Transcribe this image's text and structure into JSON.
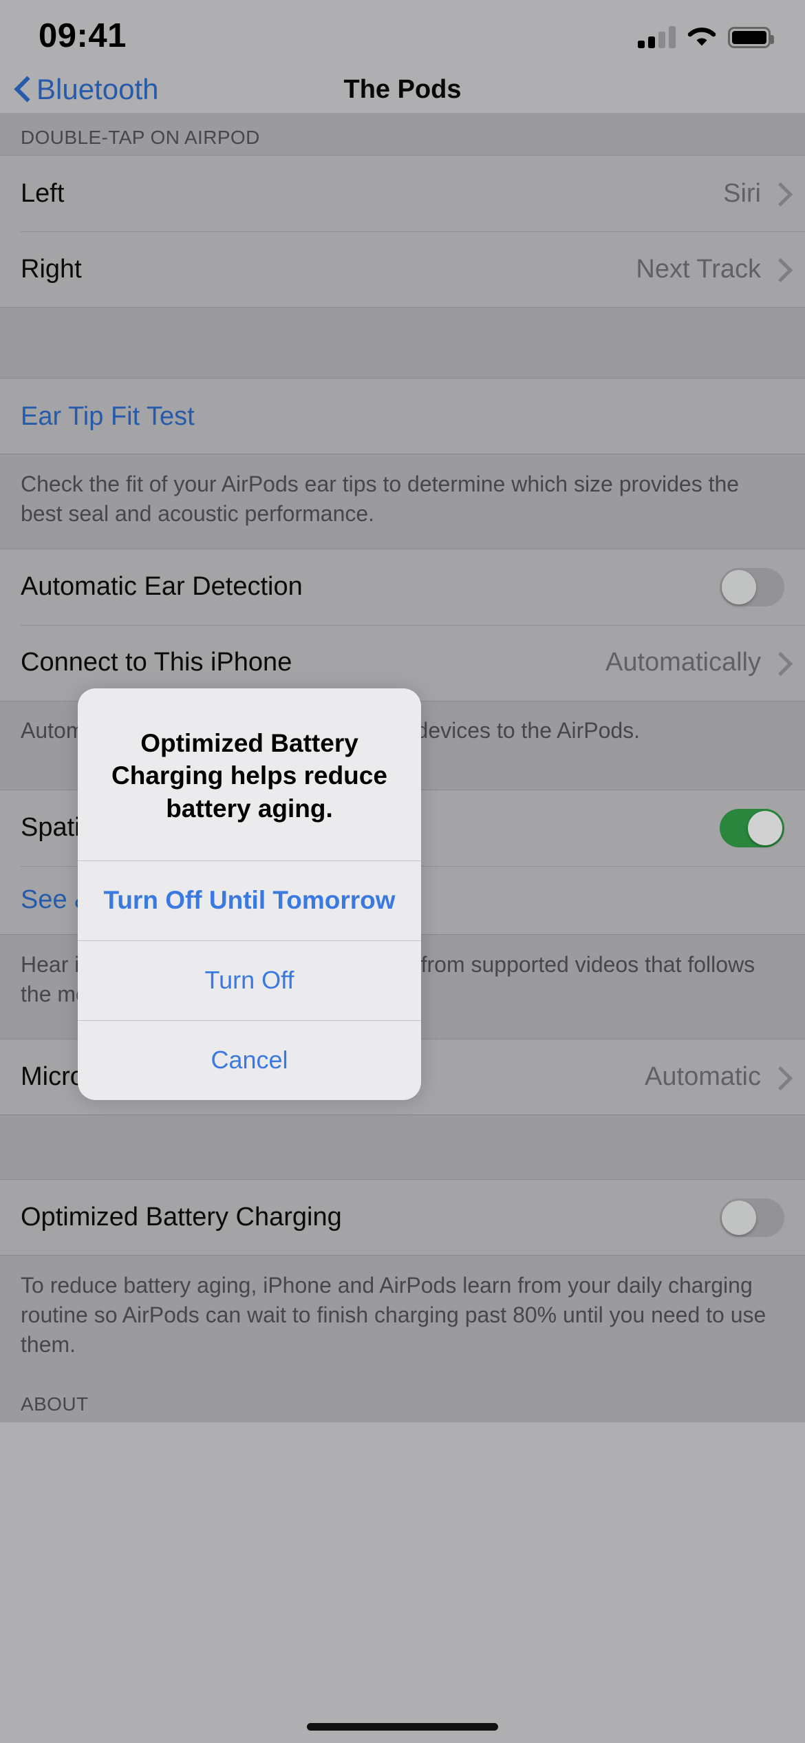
{
  "status_bar": {
    "time": "09:41",
    "cellular_icon": "cellular-signal-icon",
    "wifi_icon": "wifi-icon",
    "battery_icon": "battery-full-icon"
  },
  "nav_bar": {
    "back_label": "Bluetooth",
    "back_icon": "chevron-left-icon",
    "title": "The Pods"
  },
  "sections": {
    "double_tap": {
      "header": "DOUBLE-TAP ON AIRPOD",
      "rows": [
        {
          "label": "Left",
          "value": "Siri"
        },
        {
          "label": "Right",
          "value": "Next Track"
        }
      ]
    },
    "ear_tip": {
      "link": "Ear Tip Fit Test",
      "footer": "Check the fit of your AirPods ear tips to determine which size provides the best seal and acoustic performance."
    },
    "automatic": {
      "row_label": "Automatic Ear Detection",
      "toggle_state": "off",
      "connect_label": "Connect to This iPhone",
      "connect_value": "Automatically",
      "footer": "Automatically connect when one of your devices to the AirPods."
    },
    "spatial": {
      "row_label": "Spatial Audio",
      "toggle_state": "on",
      "link": "See & Hear How It Works",
      "footer": "Hear immersive three dimensional audio from supported videos that follows the movement of your iPhone."
    },
    "microphone": {
      "label": "Microphone",
      "value": "Automatic"
    },
    "battery": {
      "label": "Optimized Battery Charging",
      "toggle_state": "off",
      "footer": "To reduce battery aging, iPhone and AirPods learn from your daily charging routine so AirPods can wait to finish charging past 80% until you need to use them."
    },
    "about": {
      "header": "ABOUT"
    }
  },
  "alert": {
    "title": "Optimized Battery Charging helps reduce battery aging.",
    "buttons": [
      {
        "label": "Turn Off Until Tomorrow",
        "style": "bold"
      },
      {
        "label": "Turn Off",
        "style": "normal"
      },
      {
        "label": "Cancel",
        "style": "normal"
      }
    ]
  },
  "colors": {
    "accent_blue": "#2f6fd0",
    "alert_blue": "#3a7ae0",
    "toggle_on_green": "#34a44a",
    "list_bg": "#c9c9cc",
    "group_bg": "#bcbcc2"
  }
}
